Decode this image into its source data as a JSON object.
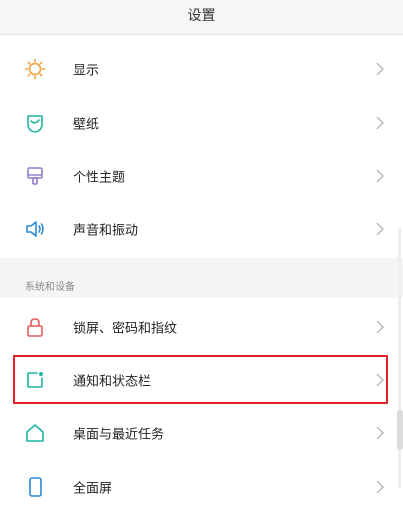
{
  "header": {
    "title": "设置"
  },
  "group1": {
    "items": [
      {
        "label": "显示",
        "icon": "sun-icon"
      },
      {
        "label": "壁纸",
        "icon": "wallpaper-icon"
      },
      {
        "label": "个性主题",
        "icon": "theme-brush-icon"
      },
      {
        "label": "声音和振动",
        "icon": "speaker-icon"
      }
    ]
  },
  "group2": {
    "title": "系统和设备",
    "items": [
      {
        "label": "锁屏、密码和指纹",
        "icon": "lock-icon"
      },
      {
        "label": "通知和状态栏",
        "icon": "notification-icon"
      },
      {
        "label": "桌面与最近任务",
        "icon": "home-icon"
      },
      {
        "label": "全面屏",
        "icon": "phone-icon"
      }
    ]
  },
  "colors": {
    "accent": "#1fb5a2",
    "highlight_border": "#e0242a",
    "icon_orange": "#f0a23a",
    "icon_purple": "#8f7acc",
    "icon_blue": "#2a8ad8",
    "icon_red": "#e65a5a"
  }
}
